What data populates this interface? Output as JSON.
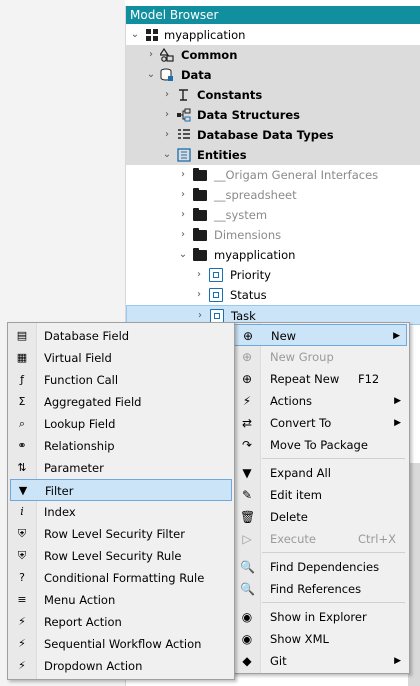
{
  "panel": {
    "title": "Model Browser"
  },
  "tree": {
    "root": "myapplication",
    "common": "Common",
    "data": "Data",
    "constants": "Constants",
    "data_structures": "Data Structures",
    "database_data_types": "Database Data Types",
    "entities": "Entities",
    "folders": [
      "__Origam General Interfaces",
      "__spreadsheet",
      "__system",
      "Dimensions",
      "myapplication"
    ],
    "entity_items": [
      "Priority",
      "Status",
      "Task"
    ]
  },
  "context_menu": {
    "new": "New",
    "new_group": "New Group",
    "repeat_new": "Repeat New",
    "repeat_new_shortcut": "F12",
    "actions": "Actions",
    "convert_to": "Convert To",
    "move_to_package": "Move To Package",
    "expand_all": "Expand All",
    "edit_item": "Edit item",
    "delete": "Delete",
    "execute": "Execute",
    "execute_shortcut": "Ctrl+X",
    "find_dependencies": "Find Dependencies",
    "find_references": "Find References",
    "show_in_explorer": "Show in Explorer",
    "show_xml": "Show XML",
    "git": "Git"
  },
  "new_submenu": {
    "items": [
      "Database Field",
      "Virtual Field",
      "Function Call",
      "Aggregated Field",
      "Lookup Field",
      "Relationship",
      "Parameter",
      "Filter",
      "Index",
      "Row Level Security Filter",
      "Row Level Security Rule",
      "Conditional Formatting Rule",
      "Menu Action",
      "Report Action",
      "Sequential Workflow Action",
      "Dropdown Action"
    ],
    "active": "Filter"
  },
  "colors": {
    "title_bar": "#118f9e",
    "selection": "#cce4f7",
    "selection_border": "#6fa8dc"
  }
}
